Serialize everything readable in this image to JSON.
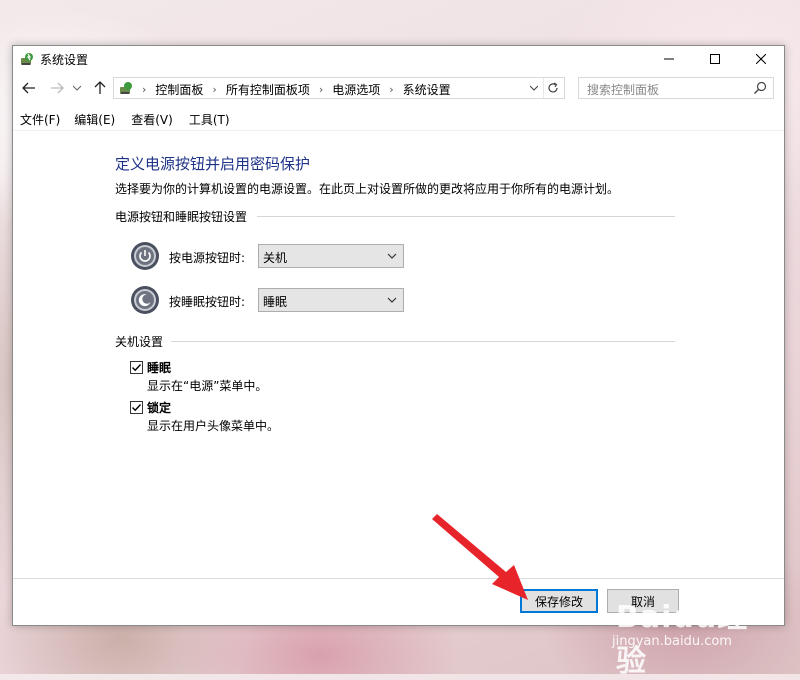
{
  "window": {
    "title": "系统设置"
  },
  "address_bar": {
    "crumbs": [
      "控制面板",
      "所有控制面板项",
      "电源选项",
      "系统设置"
    ],
    "search_placeholder": "搜索控制面板"
  },
  "menu": [
    "文件(F)",
    "编辑(E)",
    "查看(V)",
    "工具(T)"
  ],
  "main": {
    "title": "定义电源按钮并启用密码保护",
    "description": "选择要为你的计算机设置的电源设置。在此页上对设置所做的更改将应用于你所有的电源计划。",
    "power_group": {
      "header": "电源按钮和睡眠按钮设置",
      "power_button_label": "按电源按钮时:",
      "power_button_value": "关机",
      "sleep_button_label": "按睡眠按钮时:",
      "sleep_button_value": "睡眠"
    },
    "shutdown_group": {
      "header": "关机设置",
      "sleep": {
        "label": "睡眠",
        "desc": "显示在“电源”菜单中。",
        "checked": true
      },
      "lock": {
        "label": "锁定",
        "desc": "显示在用户头像菜单中。",
        "checked": true
      }
    }
  },
  "footer": {
    "save_label": "保存修改",
    "cancel_label": "取消"
  },
  "watermark": {
    "brand": "Baidu经验",
    "url": "jingyan.baidu.com"
  },
  "colors": {
    "title_blue": "#1e3287",
    "annotation_red": "#e8242b",
    "focus_blue": "#0078d7"
  }
}
